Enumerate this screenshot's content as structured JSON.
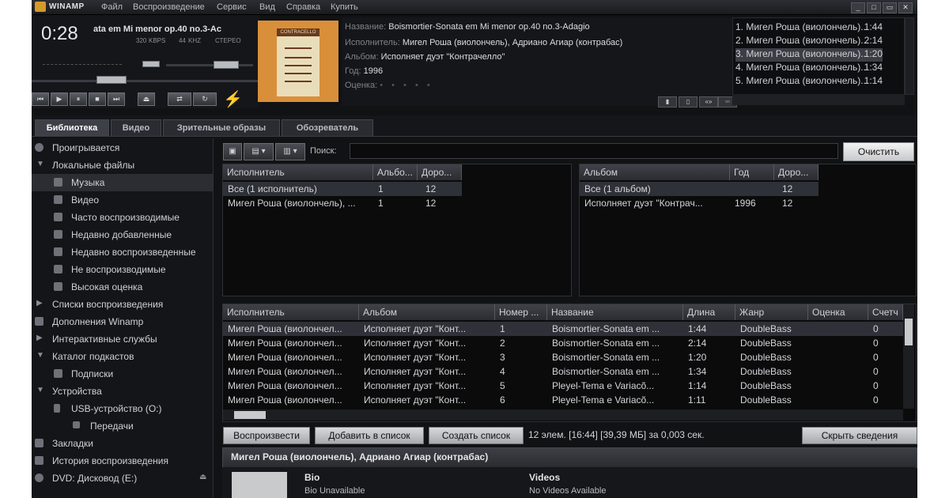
{
  "app": {
    "brand": "WINAMP"
  },
  "menu": [
    "Файл",
    "Воспроизведение",
    "Сервис",
    "Вид",
    "Справка",
    "Купить"
  ],
  "player": {
    "time": "0:28",
    "marquee": "ata em Mi menor op.40 no.3-Ac",
    "bitrate": "320",
    "bitrate_unit": "KBPS",
    "samplerate": "44",
    "samplerate_unit": "KHZ",
    "mode": "СТЕРЕО"
  },
  "album_art": {
    "label": "CONTRACELLO"
  },
  "track_info": {
    "title_key": "Название:",
    "title": "Boismortier-Sonata em Mi menor op.40 no.3-Adagio",
    "artist_key": "Исполнитель:",
    "artist": "Мигел Роша (виолончель), Адриано Агиар (контрабас)",
    "album_key": "Альбом:",
    "album": "Исполняет дуэт \"Контрачелло\"",
    "year_key": "Год:",
    "year": "1996",
    "rating_key": "Оценка:",
    "rating": "• • • • •"
  },
  "playlist": [
    {
      "label": "1. Мигел Роша (виолончель)...",
      "duration": "1:44"
    },
    {
      "label": "2. Мигел Роша (виолончель)...",
      "duration": "2:14"
    },
    {
      "label": "3. Мигел Роша (виолончель)...",
      "duration": "1:20"
    },
    {
      "label": "4. Мигел Роша (виолончель)...",
      "duration": "1:34"
    },
    {
      "label": "5. Мигел Роша (виолончель)...",
      "duration": "1:14"
    }
  ],
  "tabs": [
    "Библиотека",
    "Видео",
    "Зрительные образы",
    "Обозреватель"
  ],
  "sidebar": [
    {
      "label": "Проигрывается"
    },
    {
      "label": "Локальные файлы"
    },
    {
      "label": "Музыка"
    },
    {
      "label": "Видео"
    },
    {
      "label": "Часто воспроизводимые"
    },
    {
      "label": "Недавно добавленные"
    },
    {
      "label": "Недавно воспроизведенные"
    },
    {
      "label": "Не воспроизводимые"
    },
    {
      "label": "Высокая оценка"
    },
    {
      "label": "Списки воспроизведения"
    },
    {
      "label": "Дополнения Winamp"
    },
    {
      "label": "Интерактивные службы"
    },
    {
      "label": "Каталог подкастов"
    },
    {
      "label": "Подписки"
    },
    {
      "label": "Устройства"
    },
    {
      "label": "USB-устройство (O:)"
    },
    {
      "label": "Передачи"
    },
    {
      "label": "Закладки"
    },
    {
      "label": "История воспроизведения"
    },
    {
      "label": "DVD: Дисковод (E:)"
    }
  ],
  "search": {
    "label": "Поиск:",
    "value": "",
    "clear": "Очистить"
  },
  "artists_pane": {
    "headers": [
      "Исполнитель",
      "Альбо...",
      "Доро..."
    ],
    "rows": [
      [
        "Все (1 исполнитель)",
        "1",
        "12"
      ],
      [
        "Мигел Роша (виолончель), ...",
        "1",
        "12"
      ]
    ]
  },
  "albums_pane": {
    "headers": [
      "Альбом",
      "Год",
      "Доро..."
    ],
    "rows": [
      [
        "Все (1 альбом)",
        "",
        "12"
      ],
      [
        "Исполняет дуэт \"Контрач...",
        "1996",
        "12"
      ]
    ]
  },
  "tracks": {
    "headers": [
      "Исполнитель",
      "Альбом",
      "Номер ...",
      "Название",
      "Длина",
      "Жанр",
      "Оценка",
      "Счетч"
    ],
    "rows": [
      [
        "Мигел Роша (виолончел...",
        "Исполняет дуэт \"Конт...",
        "1",
        "Boismortier-Sonata em ...",
        "1:44",
        "DoubleBass",
        "",
        "0"
      ],
      [
        "Мигел Роша (виолончел...",
        "Исполняет дуэт \"Конт...",
        "2",
        "Boismortier-Sonata em ...",
        "2:14",
        "DoubleBass",
        "",
        "0"
      ],
      [
        "Мигел Роша (виолончел...",
        "Исполняет дуэт \"Конт...",
        "3",
        "Boismortier-Sonata em ...",
        "1:20",
        "DoubleBass",
        "",
        "0"
      ],
      [
        "Мигел Роша (виолончел...",
        "Исполняет дуэт \"Конт...",
        "4",
        "Boismortier-Sonata em ...",
        "1:34",
        "DoubleBass",
        "",
        "0"
      ],
      [
        "Мигел Роша (виолончел...",
        "Исполняет дуэт \"Конт...",
        "5",
        "Pleyel-Tema e Variacõ...",
        "1:14",
        "DoubleBass",
        "",
        "0"
      ],
      [
        "Мигел Роша (виолончел...",
        "Исполняет дуэт \"Конт...",
        "6",
        "Pleyel-Tema e Variacõ...",
        "1:11",
        "DoubleBass",
        "",
        "0"
      ]
    ]
  },
  "actions": {
    "play": "Воспроизвести",
    "add": "Добавить в список",
    "create": "Создать список",
    "status": "12 элем. [16:44] [39,39 МБ] за 0,003 сек.",
    "hide": "Скрыть сведения"
  },
  "info": {
    "artist": "Мигел Роша (виолончель), Адриано Агиар (контрабас)",
    "bio_title": "Bio",
    "bio_text": "Bio Unavailable",
    "videos_title": "Videos",
    "videos_text": "No Videos Available"
  }
}
